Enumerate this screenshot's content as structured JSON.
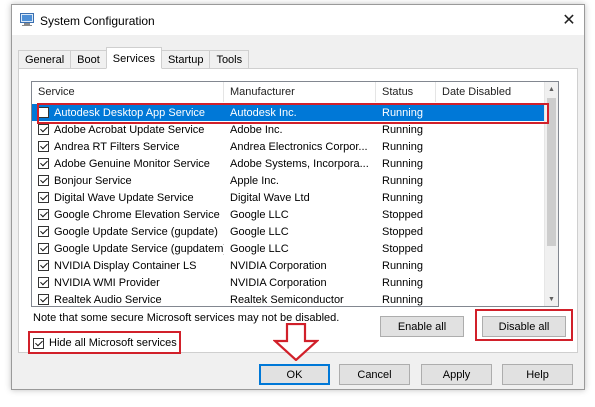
{
  "window": {
    "title": "System Configuration",
    "close_glyph": "✕"
  },
  "tabs": [
    {
      "label": "General",
      "active": false
    },
    {
      "label": "Boot",
      "active": false
    },
    {
      "label": "Services",
      "active": true
    },
    {
      "label": "Startup",
      "active": false
    },
    {
      "label": "Tools",
      "active": false
    }
  ],
  "services": {
    "columns": {
      "service": "Service",
      "manufacturer": "Manufacturer",
      "status": "Status",
      "date_disabled": "Date Disabled"
    },
    "rows": [
      {
        "checked": false,
        "name": "Autodesk Desktop App Service",
        "manufacturer": "Autodesk Inc.",
        "status": "Running",
        "date_disabled": "",
        "selected": true
      },
      {
        "checked": true,
        "name": "Adobe Acrobat Update Service",
        "manufacturer": "Adobe Inc.",
        "status": "Running",
        "date_disabled": ""
      },
      {
        "checked": true,
        "name": "Andrea RT Filters Service",
        "manufacturer": "Andrea Electronics Corpor...",
        "status": "Running",
        "date_disabled": ""
      },
      {
        "checked": true,
        "name": "Adobe Genuine Monitor Service",
        "manufacturer": "Adobe Systems, Incorpora...",
        "status": "Running",
        "date_disabled": ""
      },
      {
        "checked": true,
        "name": "Bonjour Service",
        "manufacturer": "Apple Inc.",
        "status": "Running",
        "date_disabled": ""
      },
      {
        "checked": true,
        "name": "Digital Wave Update Service",
        "manufacturer": "Digital Wave Ltd",
        "status": "Running",
        "date_disabled": ""
      },
      {
        "checked": true,
        "name": "Google Chrome Elevation Service",
        "manufacturer": "Google LLC",
        "status": "Stopped",
        "date_disabled": ""
      },
      {
        "checked": true,
        "name": "Google Update Service (gupdate)",
        "manufacturer": "Google LLC",
        "status": "Stopped",
        "date_disabled": ""
      },
      {
        "checked": true,
        "name": "Google Update Service (gupdatem)",
        "manufacturer": "Google LLC",
        "status": "Stopped",
        "date_disabled": ""
      },
      {
        "checked": true,
        "name": "NVIDIA Display Container LS",
        "manufacturer": "NVIDIA Corporation",
        "status": "Running",
        "date_disabled": ""
      },
      {
        "checked": true,
        "name": "NVIDIA WMI Provider",
        "manufacturer": "NVIDIA Corporation",
        "status": "Running",
        "date_disabled": ""
      },
      {
        "checked": true,
        "name": "Realtek Audio Service",
        "manufacturer": "Realtek Semiconductor",
        "status": "Running",
        "date_disabled": ""
      }
    ]
  },
  "note": "Note that some secure Microsoft services may not be disabled.",
  "buttons": {
    "enable_all": "Enable all",
    "disable_all": "Disable all",
    "ok": "OK",
    "cancel": "Cancel",
    "apply": "Apply",
    "help": "Help"
  },
  "hide_ms": {
    "label": "Hide all Microsoft services",
    "checked": true
  },
  "colors": {
    "highlight_red": "#d1202a",
    "selection_blue": "#0078d7"
  }
}
